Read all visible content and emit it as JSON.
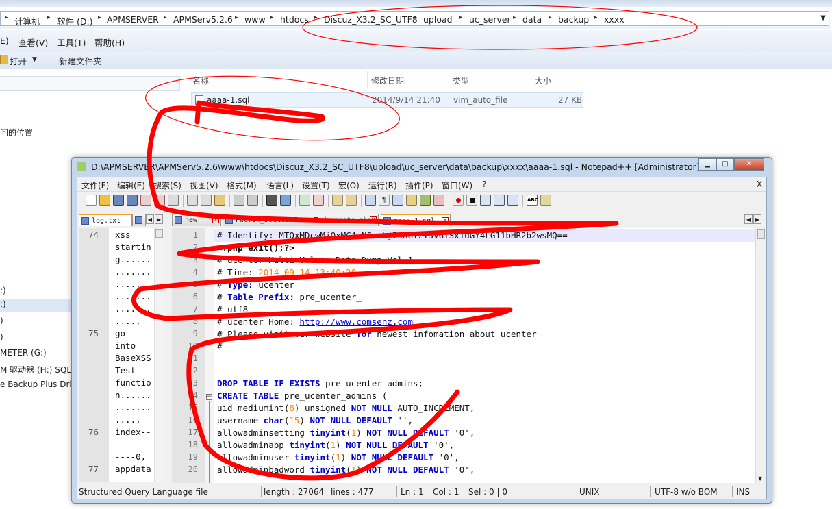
{
  "explorer": {
    "breadcrumb": [
      "计算机",
      "软件 (D:)",
      "APMSERVER",
      "APMServ5.2.6",
      "www",
      "htdocs",
      "Discuz_X3.2_SC_UTF8",
      "upload",
      "uc_server",
      "data",
      "backup",
      "xxxx"
    ],
    "menu": {
      "edit": "E)",
      "view": "查看(V)",
      "tools": "工具(T)",
      "help": "帮助(H)"
    },
    "toolbar": {
      "open": "打开",
      "new_folder": "新建文件夹"
    },
    "nav": {
      "location": "问的位置",
      "drives": [
        ":)",
        ":)",
        ")",
        ")",
        "METER (G:)",
        "M 驱动器 (H:) SQLI",
        "e Backup Plus Driv"
      ]
    },
    "columns": {
      "name": "名称",
      "modified": "修改日期",
      "type": "类型",
      "size": "大小"
    },
    "file": {
      "name": "aaaa-1.sql",
      "modified": "2014/9/14 21:40",
      "type": "vim_auto_file",
      "size": "27 KB"
    }
  },
  "notepad": {
    "title": "D:\\APMSERVER\\APMServ5.2.6\\www\\htdocs\\Discuz_X3.2_SC_UTF8\\upload\\uc_server\\data\\backup\\xxxx\\aaaa-1.sql - Notepad++ [Administrator]",
    "menu": [
      "文件(F)",
      "编辑(E)",
      "搜索(S)",
      "视图(V)",
      "格式(M)",
      "语言(L)",
      "设置(T)",
      "宏(O)",
      "运行(R)",
      "插件(P)",
      "窗口(W)",
      "?"
    ],
    "close_x": "X",
    "left_tab": "log.txt",
    "tabs": [
      "new",
      "PwCron_DoClearForumTodayposts.php",
      "aaaa-1.sql"
    ],
    "left_lines": [
      {
        "n": "74",
        "t": "xss"
      },
      {
        "n": "",
        "t": "startin"
      },
      {
        "n": "",
        "t": "g......"
      },
      {
        "n": "",
        "t": "......."
      },
      {
        "n": "",
        "t": "......."
      },
      {
        "n": "",
        "t": "......."
      },
      {
        "n": "",
        "t": "......."
      },
      {
        "n": "",
        "t": "....,"
      },
      {
        "n": "75",
        "t": "go"
      },
      {
        "n": "",
        "t": "into"
      },
      {
        "n": "",
        "t": "BaseXSS"
      },
      {
        "n": "",
        "t": "Test"
      },
      {
        "n": "",
        "t": "functio"
      },
      {
        "n": "",
        "t": "n......"
      },
      {
        "n": "",
        "t": "......."
      },
      {
        "n": "",
        "t": "....,"
      },
      {
        "n": "76",
        "t": "index--"
      },
      {
        "n": "",
        "t": "-------"
      },
      {
        "n": "",
        "t": "----0,"
      },
      {
        "n": "77",
        "t": "appdata"
      }
    ],
    "line_numbers": [
      "1",
      "2",
      "3",
      "4",
      "5",
      "6",
      "7",
      "8",
      "9",
      "10",
      "11",
      "12",
      "13",
      "14",
      "15",
      "16",
      "17",
      "18",
      "19",
      "20"
    ],
    "code": {
      "l1": "# Identify: MTQxMDcwMjQxMC4wNCwzLjIsRGlzY3V6ISx1dGY4LG11bHR2b2wsMQ==",
      "l2": "<?php exit();?>",
      "l3": "# ucenter Multi-Volume Data Dump Vol.1",
      "l4a": "# Time: ",
      "l4b": "2014-09-14 13:40:20",
      "l5a": "# ",
      "l5b": "Type:",
      "l5c": " ucenter",
      "l6a": "# ",
      "l6b": "Table Prefix:",
      "l6c": " pre_ucenter_",
      "l7": "# utf8",
      "l8a": "# ucenter Home: ",
      "l8b": "http://www.comsenz.com",
      "l9a": "# Please visit our website ",
      "l9b": "for",
      "l9c": " newest infomation about ucenter",
      "l10": "# --------------------------------------------------------",
      "l13a": "DROP TABLE IF EXISTS",
      "l13b": " pre_ucenter_admins;",
      "l14a": "CREATE TABLE",
      "l14b": " pre_ucenter_admins (",
      "l15a": "  uid mediumint(",
      "l15b": "8",
      "l15c": ") unsigned ",
      "l15d": "NOT NULL",
      "l15e": " AUTO_INCREMENT,",
      "l16a": "  username ",
      "l16b": "char",
      "l16c": "(",
      "l16d": "15",
      "l16e": ") ",
      "l16f": "NOT NULL DEFAULT",
      "l16g": " '',",
      "l17a": "  allowadminsetting ",
      "l17b": "tinyint",
      "l17c": "(",
      "l17d": "1",
      "l17e": ") ",
      "l17f": "NOT NULL DEFAULT",
      "l17g": " '0',",
      "l18a": "  allowadminapp ",
      "l18b": "tinyint",
      "l18c": "(",
      "l18d": "1",
      "l18e": ") ",
      "l18f": "NOT NULL DEFAULT",
      "l18g": " '0',",
      "l19a": "  allowadminuser ",
      "l19b": "tinyint",
      "l19c": "(",
      "l19d": "1",
      "l19e": ") ",
      "l19f": "NOT NULL DEFAULT",
      "l19g": " '0',",
      "l20a": "  allowadminbadword ",
      "l20b": "tinyint",
      "l20c": "(",
      "l20d": "1",
      "l20e": ") ",
      "l20f": "NOT NULL DEFAULT",
      "l20g": " '0',"
    },
    "status": {
      "lang": "Structured Query Language file",
      "length": "length : 27064",
      "lines": "lines : 477",
      "ln": "Ln : 1",
      "col": "Col : 1",
      "sel": "Sel : 0 | 0",
      "eol": "UNIX",
      "enc": "UTF-8 w/o BOM",
      "ins": "INS"
    }
  },
  "colors": {
    "annotation": "#ff0000",
    "keyword": "#0000d0",
    "number": "#ff8000"
  }
}
